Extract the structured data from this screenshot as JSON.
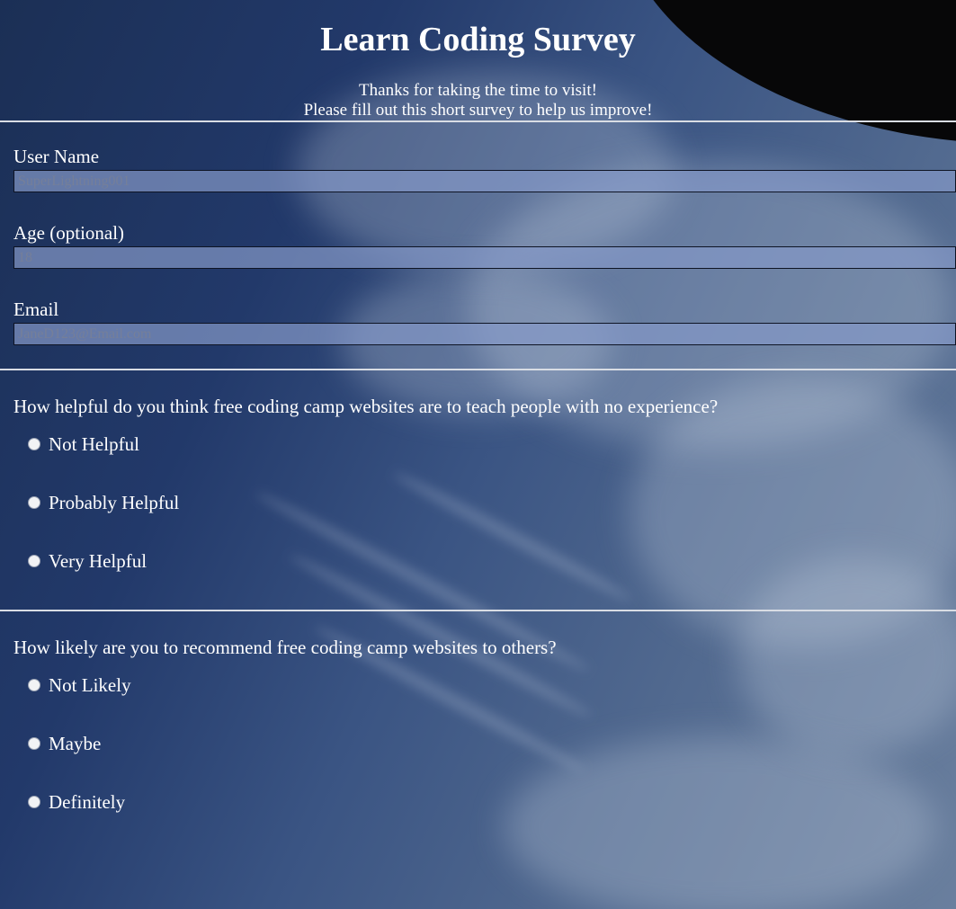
{
  "header": {
    "title": "Learn Coding Survey",
    "intro_line1": "Thanks for taking the time to visit!",
    "intro_line2": "Please fill out this short survey to help us improve!"
  },
  "fields": {
    "username": {
      "label": "User Name",
      "value": "",
      "placeholder": "SuperLightning001"
    },
    "age": {
      "label": "Age (optional)",
      "value": "",
      "placeholder": "18"
    },
    "email": {
      "label": "Email",
      "value": "",
      "placeholder": "JaneD123@Email.com"
    }
  },
  "question1": {
    "text": "How helpful do you think free coding camp websites are to teach people with no experience?",
    "options": [
      "Not Helpful",
      "Probably Helpful",
      "Very Helpful"
    ]
  },
  "question2": {
    "text": "How likely are you to recommend free coding camp websites to others?",
    "options": [
      "Not Likely",
      "Maybe",
      "Definitely"
    ]
  },
  "colors": {
    "text": "#ffffff",
    "divider": "#d9dde4",
    "input_bg": "#8498c8"
  }
}
